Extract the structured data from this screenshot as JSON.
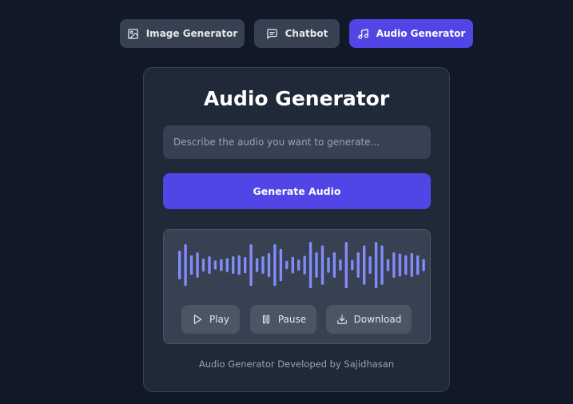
{
  "tabs": [
    {
      "label": "Image Generator",
      "icon": "image-icon",
      "active": false
    },
    {
      "label": "Chatbot",
      "icon": "chat-icon",
      "active": false
    },
    {
      "label": "Audio Generator",
      "icon": "music-note-icon",
      "active": true
    }
  ],
  "card": {
    "title": "Audio Generator",
    "prompt_placeholder": "Describe the audio you want to generate...",
    "prompt_value": "",
    "generate_label": "Generate Audio"
  },
  "player": {
    "waveform_levels": [
      0.62,
      0.9,
      0.42,
      0.55,
      0.28,
      0.38,
      0.2,
      0.26,
      0.3,
      0.38,
      0.42,
      0.35,
      0.9,
      0.3,
      0.38,
      0.52,
      0.9,
      0.7,
      0.18,
      0.36,
      0.24,
      0.4,
      1.0,
      0.55,
      0.85,
      0.34,
      0.55,
      0.24,
      1.0,
      0.22,
      0.55,
      0.85,
      0.38,
      1.0,
      0.85,
      0.26,
      0.55,
      0.5,
      0.42,
      0.52,
      0.42,
      0.26
    ],
    "play_label": "Play",
    "pause_label": "Pause",
    "download_label": "Download"
  },
  "footer": "Audio Generator Developed by Sajidhasan",
  "colors": {
    "background": "#111827",
    "card": "#1f2937",
    "accent": "#4f46e5",
    "waveform": "#818cf8"
  }
}
